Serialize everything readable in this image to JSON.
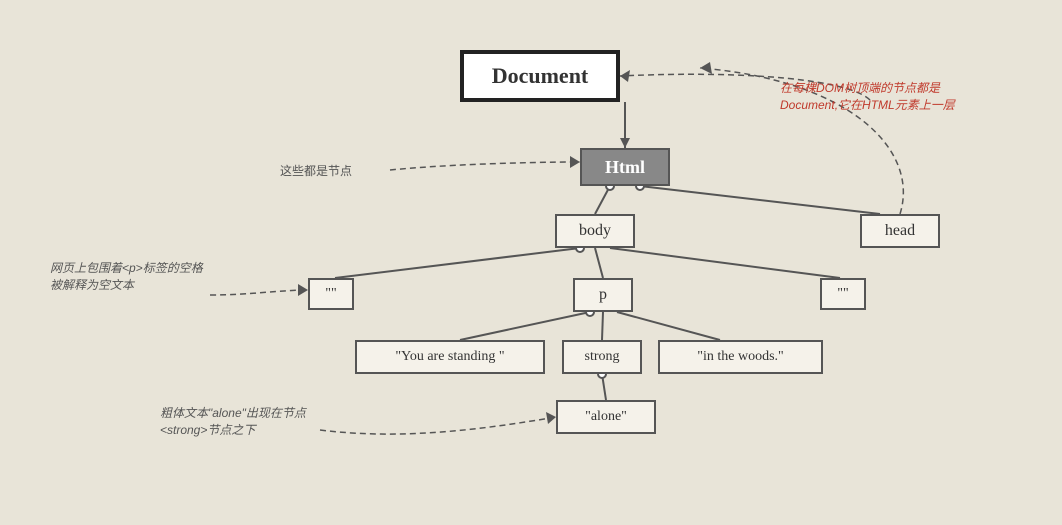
{
  "nodes": {
    "document": {
      "label": "Document"
    },
    "html": {
      "label": "Html"
    },
    "body": {
      "label": "body"
    },
    "head": {
      "label": "head"
    },
    "p": {
      "label": "p"
    },
    "quote_left": {
      "label": "\"\""
    },
    "quote_right": {
      "label": "\"\""
    },
    "you_are": {
      "label": "\"You are standing \""
    },
    "strong": {
      "label": "strong"
    },
    "in_the_woods": {
      "label": "\"in the woods.\""
    },
    "alone": {
      "label": "\"alone\""
    }
  },
  "annotations": {
    "document_desc": "在每棵DOM树顶端的节点都是Document,它在HTML元素上一层",
    "document_highlight": "Document",
    "nodes_label": "这些都是节点",
    "whitespace_label": "网页上包围着<p>标签的空格被解释为空文本",
    "alone_label": "粗体文本\"alone\"出现在节点<strong>节点之下"
  },
  "colors": {
    "background": "#e8e4d8",
    "node_border": "#555",
    "node_bg": "#f5f2ea",
    "html_bg": "#888",
    "document_border": "#222",
    "line_color": "#555",
    "accent_red": "#c0392b"
  }
}
